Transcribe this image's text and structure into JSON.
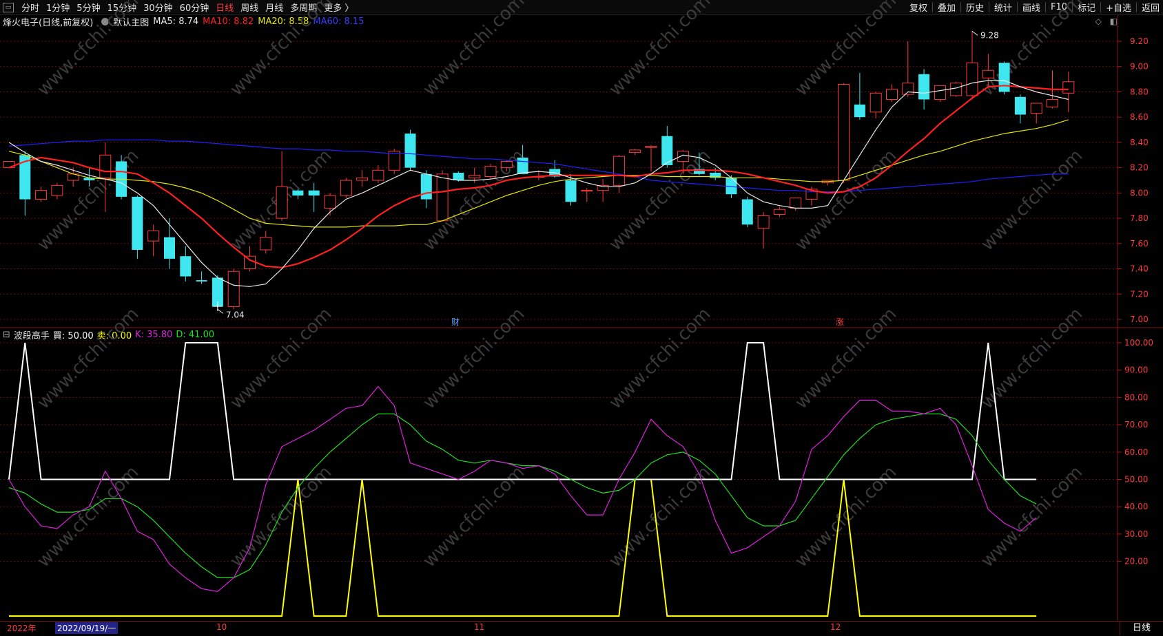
{
  "toolbar": {
    "window_icon": "restore-icon",
    "periods": [
      "分时",
      "1分钟",
      "5分钟",
      "15分钟",
      "30分钟",
      "60分钟",
      "日线",
      "周线",
      "月线",
      "多周期",
      "更多 〉"
    ],
    "active_period": "日线",
    "right_items": [
      "复权",
      "叠加",
      "历史",
      "统计",
      "画线",
      "F10",
      "标记",
      "+自选",
      "返回"
    ]
  },
  "main_chart": {
    "stock_title": "烽火电子(日线,前复权)",
    "main_indicator": "默认主图",
    "ma5": "MA5: 8.74",
    "ma10": "MA10: 8.82",
    "ma20": "MA20: 8.58",
    "ma60": "MA60: 8.15",
    "high_label": "9.28",
    "low_label": "7.04",
    "event_labels": [
      "财",
      "涨"
    ],
    "price_ticks": [
      "9.20",
      "9.00",
      "8.80",
      "8.60",
      "8.40",
      "8.20",
      "8.00",
      "7.80",
      "7.60",
      "7.40",
      "7.20",
      "7.00"
    ],
    "watermark": "www.cfchi.com"
  },
  "indicator": {
    "name": "波段高手",
    "buy_label": "買: 50.00",
    "sell_label": "卖: 0.00",
    "k_label": "K: 35.80",
    "d_label": "D: 41.00",
    "ticks": [
      "100.00",
      "90.00",
      "80.00",
      "70.00",
      "60.00",
      "50.00",
      "40.00",
      "30.00",
      "20.00"
    ]
  },
  "time_axis": {
    "year_label": "2022年",
    "cursor_date": "2022/09/19/一",
    "months": [
      "10",
      "11",
      "12"
    ],
    "period_label": "日线"
  },
  "colors": {
    "up": "#ff3b3b",
    "down": "#3ee7f0",
    "ma5": "#e8e8e8",
    "ma10": "#ff2020",
    "ma20": "#e6e600",
    "ma60": "#2020ff",
    "k": "#e020e0",
    "d": "#20e020",
    "buy": "#ffffff",
    "sell": "#ffff00",
    "grid": "#6a0f0f"
  },
  "chart_data": {
    "type": "candlestick",
    "candles": [
      {
        "o": 8.2,
        "h": 8.25,
        "l": 8.2,
        "c": 8.25
      },
      {
        "o": 8.3,
        "h": 8.33,
        "l": 7.82,
        "c": 7.95
      },
      {
        "o": 7.95,
        "h": 8.05,
        "l": 7.93,
        "c": 8.02
      },
      {
        "o": 7.98,
        "h": 8.08,
        "l": 7.95,
        "c": 8.06
      },
      {
        "o": 8.1,
        "h": 8.2,
        "l": 8.05,
        "c": 8.15
      },
      {
        "o": 8.12,
        "h": 8.2,
        "l": 8.05,
        "c": 8.1
      },
      {
        "o": 8.12,
        "h": 8.4,
        "l": 7.85,
        "c": 8.3
      },
      {
        "o": 8.25,
        "h": 8.3,
        "l": 7.95,
        "c": 7.97
      },
      {
        "o": 7.97,
        "h": 7.98,
        "l": 7.48,
        "c": 7.55
      },
      {
        "o": 7.62,
        "h": 7.75,
        "l": 7.5,
        "c": 7.7
      },
      {
        "o": 7.65,
        "h": 7.8,
        "l": 7.4,
        "c": 7.48
      },
      {
        "o": 7.5,
        "h": 7.58,
        "l": 7.3,
        "c": 7.34
      },
      {
        "o": 7.31,
        "h": 7.38,
        "l": 7.28,
        "c": 7.3
      },
      {
        "o": 7.33,
        "h": 7.35,
        "l": 7.08,
        "c": 7.1
      },
      {
        "o": 7.1,
        "h": 7.4,
        "l": 7.08,
        "c": 7.38
      },
      {
        "o": 7.4,
        "h": 7.58,
        "l": 7.38,
        "c": 7.5
      },
      {
        "o": 7.55,
        "h": 7.7,
        "l": 7.52,
        "c": 7.65
      },
      {
        "o": 7.8,
        "h": 8.33,
        "l": 7.78,
        "c": 8.05
      },
      {
        "o": 8.02,
        "h": 8.03,
        "l": 7.95,
        "c": 7.98
      },
      {
        "o": 8.02,
        "h": 8.08,
        "l": 7.85,
        "c": 7.98
      },
      {
        "o": 7.88,
        "h": 8.0,
        "l": 7.82,
        "c": 7.98
      },
      {
        "o": 7.98,
        "h": 8.12,
        "l": 7.96,
        "c": 8.1
      },
      {
        "o": 8.1,
        "h": 8.18,
        "l": 8.05,
        "c": 8.12
      },
      {
        "o": 8.1,
        "h": 8.22,
        "l": 8.08,
        "c": 8.18
      },
      {
        "o": 8.18,
        "h": 8.35,
        "l": 8.15,
        "c": 8.33
      },
      {
        "o": 8.47,
        "h": 8.5,
        "l": 8.18,
        "c": 8.2
      },
      {
        "o": 8.15,
        "h": 8.18,
        "l": 7.88,
        "c": 7.95
      },
      {
        "o": 7.78,
        "h": 8.18,
        "l": 7.78,
        "c": 8.15
      },
      {
        "o": 8.16,
        "h": 8.17,
        "l": 8.09,
        "c": 8.1
      },
      {
        "o": 8.12,
        "h": 8.2,
        "l": 8.08,
        "c": 8.14
      },
      {
        "o": 8.13,
        "h": 8.23,
        "l": 8.11,
        "c": 8.21
      },
      {
        "o": 8.2,
        "h": 8.26,
        "l": 8.17,
        "c": 8.25
      },
      {
        "o": 8.28,
        "h": 8.38,
        "l": 8.15,
        "c": 8.15
      },
      {
        "o": 8.13,
        "h": 8.18,
        "l": 8.1,
        "c": 8.13
      },
      {
        "o": 8.19,
        "h": 8.26,
        "l": 8.12,
        "c": 8.13
      },
      {
        "o": 8.1,
        "h": 8.15,
        "l": 7.9,
        "c": 7.93
      },
      {
        "o": 8.02,
        "h": 8.04,
        "l": 7.93,
        "c": 8.02
      },
      {
        "o": 8.02,
        "h": 8.11,
        "l": 7.93,
        "c": 8.06
      },
      {
        "o": 8.06,
        "h": 8.3,
        "l": 8.0,
        "c": 8.29
      },
      {
        "o": 8.32,
        "h": 8.35,
        "l": 8.3,
        "c": 8.34
      },
      {
        "o": 8.36,
        "h": 8.38,
        "l": 8.17,
        "c": 8.37
      },
      {
        "o": 8.45,
        "h": 8.53,
        "l": 8.2,
        "c": 8.22
      },
      {
        "o": 8.25,
        "h": 8.34,
        "l": 8.15,
        "c": 8.33
      },
      {
        "o": 8.19,
        "h": 8.32,
        "l": 8.14,
        "c": 8.15
      },
      {
        "o": 8.16,
        "h": 8.2,
        "l": 8.1,
        "c": 8.12
      },
      {
        "o": 8.12,
        "h": 8.14,
        "l": 7.96,
        "c": 7.99
      },
      {
        "o": 7.95,
        "h": 7.97,
        "l": 7.73,
        "c": 7.75
      },
      {
        "o": 7.72,
        "h": 7.85,
        "l": 7.56,
        "c": 7.82
      },
      {
        "o": 7.83,
        "h": 7.89,
        "l": 7.81,
        "c": 7.87
      },
      {
        "o": 7.88,
        "h": 7.96,
        "l": 7.86,
        "c": 7.96
      },
      {
        "o": 7.95,
        "h": 8.05,
        "l": 7.9,
        "c": 8.03
      },
      {
        "o": 8.08,
        "h": 8.1,
        "l": 8.06,
        "c": 8.1
      },
      {
        "o": 8.1,
        "h": 8.87,
        "l": 8.08,
        "c": 8.86
      },
      {
        "o": 8.7,
        "h": 8.95,
        "l": 8.58,
        "c": 8.6
      },
      {
        "o": 8.64,
        "h": 8.8,
        "l": 8.59,
        "c": 8.79
      },
      {
        "o": 8.74,
        "h": 8.86,
        "l": 8.72,
        "c": 8.82
      },
      {
        "o": 8.78,
        "h": 9.2,
        "l": 8.76,
        "c": 8.87
      },
      {
        "o": 8.94,
        "h": 8.98,
        "l": 8.66,
        "c": 8.74
      },
      {
        "o": 8.74,
        "h": 8.84,
        "l": 8.72,
        "c": 8.85
      },
      {
        "o": 8.77,
        "h": 8.88,
        "l": 8.76,
        "c": 8.87
      },
      {
        "o": 8.77,
        "h": 9.28,
        "l": 8.74,
        "c": 9.03
      },
      {
        "o": 8.91,
        "h": 9.1,
        "l": 8.85,
        "c": 8.97
      },
      {
        "o": 9.03,
        "h": 9.04,
        "l": 8.78,
        "c": 8.8
      },
      {
        "o": 8.76,
        "h": 8.78,
        "l": 8.55,
        "c": 8.62
      },
      {
        "o": 8.63,
        "h": 8.71,
        "l": 8.55,
        "c": 8.71
      },
      {
        "o": 8.68,
        "h": 8.97,
        "l": 8.67,
        "c": 8.74
      },
      {
        "o": 8.79,
        "h": 8.96,
        "l": 8.64,
        "c": 8.88
      }
    ],
    "ma5": [
      8.4,
      8.32,
      8.25,
      8.22,
      8.18,
      8.14,
      8.11,
      8.08,
      8.0,
      7.9,
      7.75,
      7.6,
      7.45,
      7.33,
      7.27,
      7.26,
      7.28,
      7.4,
      7.55,
      7.72,
      7.85,
      7.95,
      8.0,
      8.06,
      8.12,
      8.18,
      8.15,
      8.12,
      8.1,
      8.1,
      8.11,
      8.13,
      8.16,
      8.17,
      8.16,
      8.12,
      8.08,
      8.05,
      8.05,
      8.08,
      8.15,
      8.24,
      8.3,
      8.28,
      8.22,
      8.12,
      8.0,
      7.93,
      7.9,
      7.88,
      7.88,
      7.9,
      8.1,
      8.3,
      8.5,
      8.68,
      8.8,
      8.79,
      8.81,
      8.83,
      8.87,
      8.89,
      8.89,
      8.84,
      8.8,
      8.77,
      8.74
    ],
    "ma10": [
      8.2,
      8.25,
      8.28,
      8.26,
      8.24,
      8.2,
      8.17,
      8.17,
      8.15,
      8.08,
      8.0,
      7.9,
      7.8,
      7.68,
      7.57,
      7.47,
      7.42,
      7.41,
      7.44,
      7.49,
      7.55,
      7.63,
      7.72,
      7.82,
      7.9,
      7.96,
      8.0,
      8.01,
      8.03,
      8.04,
      8.06,
      8.1,
      8.12,
      8.13,
      8.14,
      8.14,
      8.14,
      8.14,
      8.14,
      8.13,
      8.15,
      8.16,
      8.18,
      8.18,
      8.18,
      8.17,
      8.15,
      8.12,
      8.09,
      8.06,
      8.02,
      8.0,
      8.01,
      8.05,
      8.12,
      8.22,
      8.33,
      8.43,
      8.55,
      8.65,
      8.75,
      8.84,
      8.85,
      8.84,
      8.83,
      8.82,
      8.82
    ],
    "ma20": [
      8.33,
      8.3,
      8.25,
      8.2,
      8.15,
      8.12,
      8.11,
      8.11,
      8.1,
      8.09,
      8.07,
      8.04,
      8.0,
      7.94,
      7.87,
      7.8,
      7.76,
      7.75,
      7.74,
      7.73,
      7.73,
      7.73,
      7.74,
      7.74,
      7.74,
      7.75,
      7.75,
      7.78,
      7.83,
      7.88,
      7.93,
      7.98,
      8.02,
      8.06,
      8.09,
      8.11,
      8.12,
      8.13,
      8.14,
      8.14,
      8.14,
      8.13,
      8.13,
      8.13,
      8.13,
      8.12,
      8.12,
      8.12,
      8.11,
      8.1,
      8.09,
      8.09,
      8.1,
      8.14,
      8.18,
      8.22,
      8.26,
      8.3,
      8.33,
      8.37,
      8.41,
      8.44,
      8.47,
      8.49,
      8.51,
      8.54,
      8.58
    ],
    "ma60": [
      8.37,
      8.38,
      8.39,
      8.4,
      8.41,
      8.41,
      8.42,
      8.42,
      8.42,
      8.42,
      8.41,
      8.41,
      8.4,
      8.39,
      8.38,
      8.37,
      8.36,
      8.35,
      8.35,
      8.34,
      8.34,
      8.33,
      8.33,
      8.32,
      8.31,
      8.31,
      8.3,
      8.29,
      8.28,
      8.27,
      8.27,
      8.26,
      8.25,
      8.24,
      8.23,
      8.21,
      8.19,
      8.17,
      8.15,
      8.13,
      8.1,
      8.09,
      8.08,
      8.07,
      8.06,
      8.05,
      8.04,
      8.03,
      8.02,
      8.02,
      8.01,
      8.01,
      8.01,
      8.02,
      8.03,
      8.04,
      8.05,
      8.06,
      8.07,
      8.08,
      8.09,
      8.11,
      8.12,
      8.13,
      8.14,
      8.15,
      8.15
    ],
    "K": [
      50,
      40,
      33,
      32,
      37,
      40,
      53,
      43,
      31,
      28,
      19,
      14,
      10,
      9,
      14,
      25,
      48,
      62,
      65,
      68,
      72,
      76,
      77,
      84,
      77,
      56,
      54,
      52,
      50,
      53,
      57,
      56,
      54,
      55,
      52,
      44,
      37,
      37,
      50,
      60,
      72,
      66,
      62,
      52,
      35,
      23,
      25,
      29,
      33,
      42,
      61,
      66,
      73,
      79,
      79,
      75,
      75,
      74,
      76,
      70,
      55,
      39,
      34,
      31,
      36,
      null
    ],
    "D": [
      47,
      45,
      41,
      38,
      38,
      39,
      43,
      43,
      40,
      35,
      29,
      23,
      18,
      14,
      14,
      17,
      26,
      38,
      47,
      54,
      60,
      65,
      70,
      74,
      74,
      70,
      64,
      61,
      57,
      56,
      57,
      56,
      55,
      55,
      53,
      50,
      47,
      45,
      46,
      50,
      56,
      59,
      60,
      57,
      52,
      44,
      36,
      33,
      33,
      35,
      43,
      51,
      59,
      65,
      70,
      72,
      73,
      74,
      74,
      72,
      66,
      57,
      50,
      44,
      41,
      null
    ],
    "buy": [
      50,
      100,
      50,
      50,
      50,
      50,
      50,
      50,
      50,
      50,
      50,
      100,
      100,
      100,
      50,
      50,
      50,
      50,
      50,
      50,
      50,
      50,
      50,
      50,
      50,
      50,
      50,
      50,
      50,
      50,
      50,
      50,
      50,
      50,
      50,
      50,
      50,
      50,
      50,
      50,
      50,
      50,
      50,
      50,
      50,
      50,
      100,
      100,
      50,
      50,
      50,
      50,
      50,
      50,
      50,
      50,
      50,
      50,
      50,
      50,
      50,
      100,
      50,
      50,
      50,
      null
    ],
    "sell": [
      0,
      0,
      0,
      0,
      0,
      0,
      0,
      0,
      0,
      0,
      0,
      0,
      0,
      0,
      0,
      0,
      0,
      0,
      50,
      0,
      0,
      0,
      50,
      0,
      0,
      0,
      0,
      0,
      0,
      0,
      0,
      0,
      0,
      0,
      0,
      0,
      0,
      0,
      0,
      50,
      50,
      0,
      0,
      0,
      0,
      0,
      0,
      0,
      0,
      0,
      0,
      0,
      50,
      0,
      0,
      0,
      0,
      0,
      0,
      0,
      0,
      0,
      0,
      0,
      0,
      null
    ],
    "price_range": [
      7.0,
      9.3
    ],
    "indicator_range": [
      0,
      100
    ]
  }
}
